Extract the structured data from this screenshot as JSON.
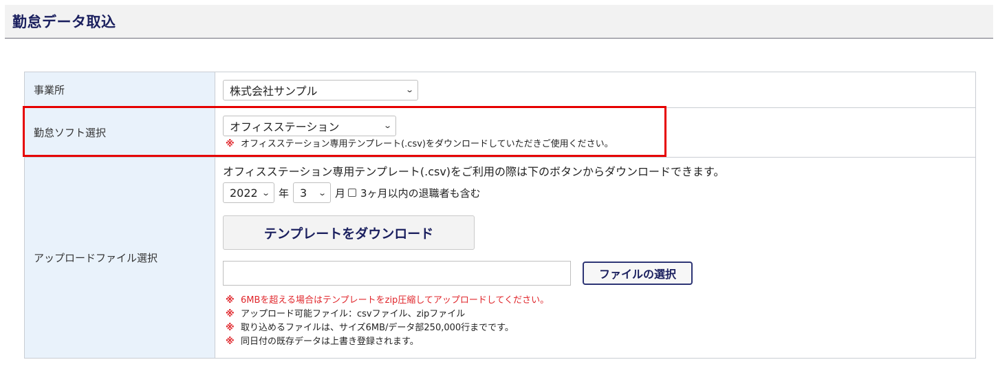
{
  "header": {
    "title": "勤怠データ取込"
  },
  "rows": {
    "office": {
      "label": "事業所",
      "selected": "株式会社サンプル"
    },
    "software": {
      "label": "勤怠ソフト選択",
      "selected": "オフィスステーション",
      "note": "オフィスステーション専用テンプレート(.csv)をダウンロードしていただきご使用ください。"
    },
    "upload": {
      "label": "アップロードファイル選択",
      "intro": "オフィスステーション専用テンプレート(.csv)をご利用の際は下のボタンからダウンロードできます。",
      "year_value": "2022",
      "year_unit": "年",
      "month_value": "3",
      "month_unit": "月",
      "checkbox_label": "3ヶ月以内の退職者も含む",
      "download_button": "テンプレートをダウンロード",
      "file_button": "ファイルの選択",
      "notes": [
        "6MBを超える場合はテンプレートをzip圧縮してアップロードしてください。",
        "アップロード可能ファイル：csvファイル、zipファイル",
        "取り込めるファイルは、サイズ6MB/データ部250,000行までです。",
        "同日付の既存データは上書き登録されます。"
      ]
    }
  },
  "mark": "※",
  "colors": {
    "title": "#1a1f5e",
    "label_bg": "#e9f2fb",
    "highlight": "#e60000",
    "warning": "#e0262b"
  }
}
